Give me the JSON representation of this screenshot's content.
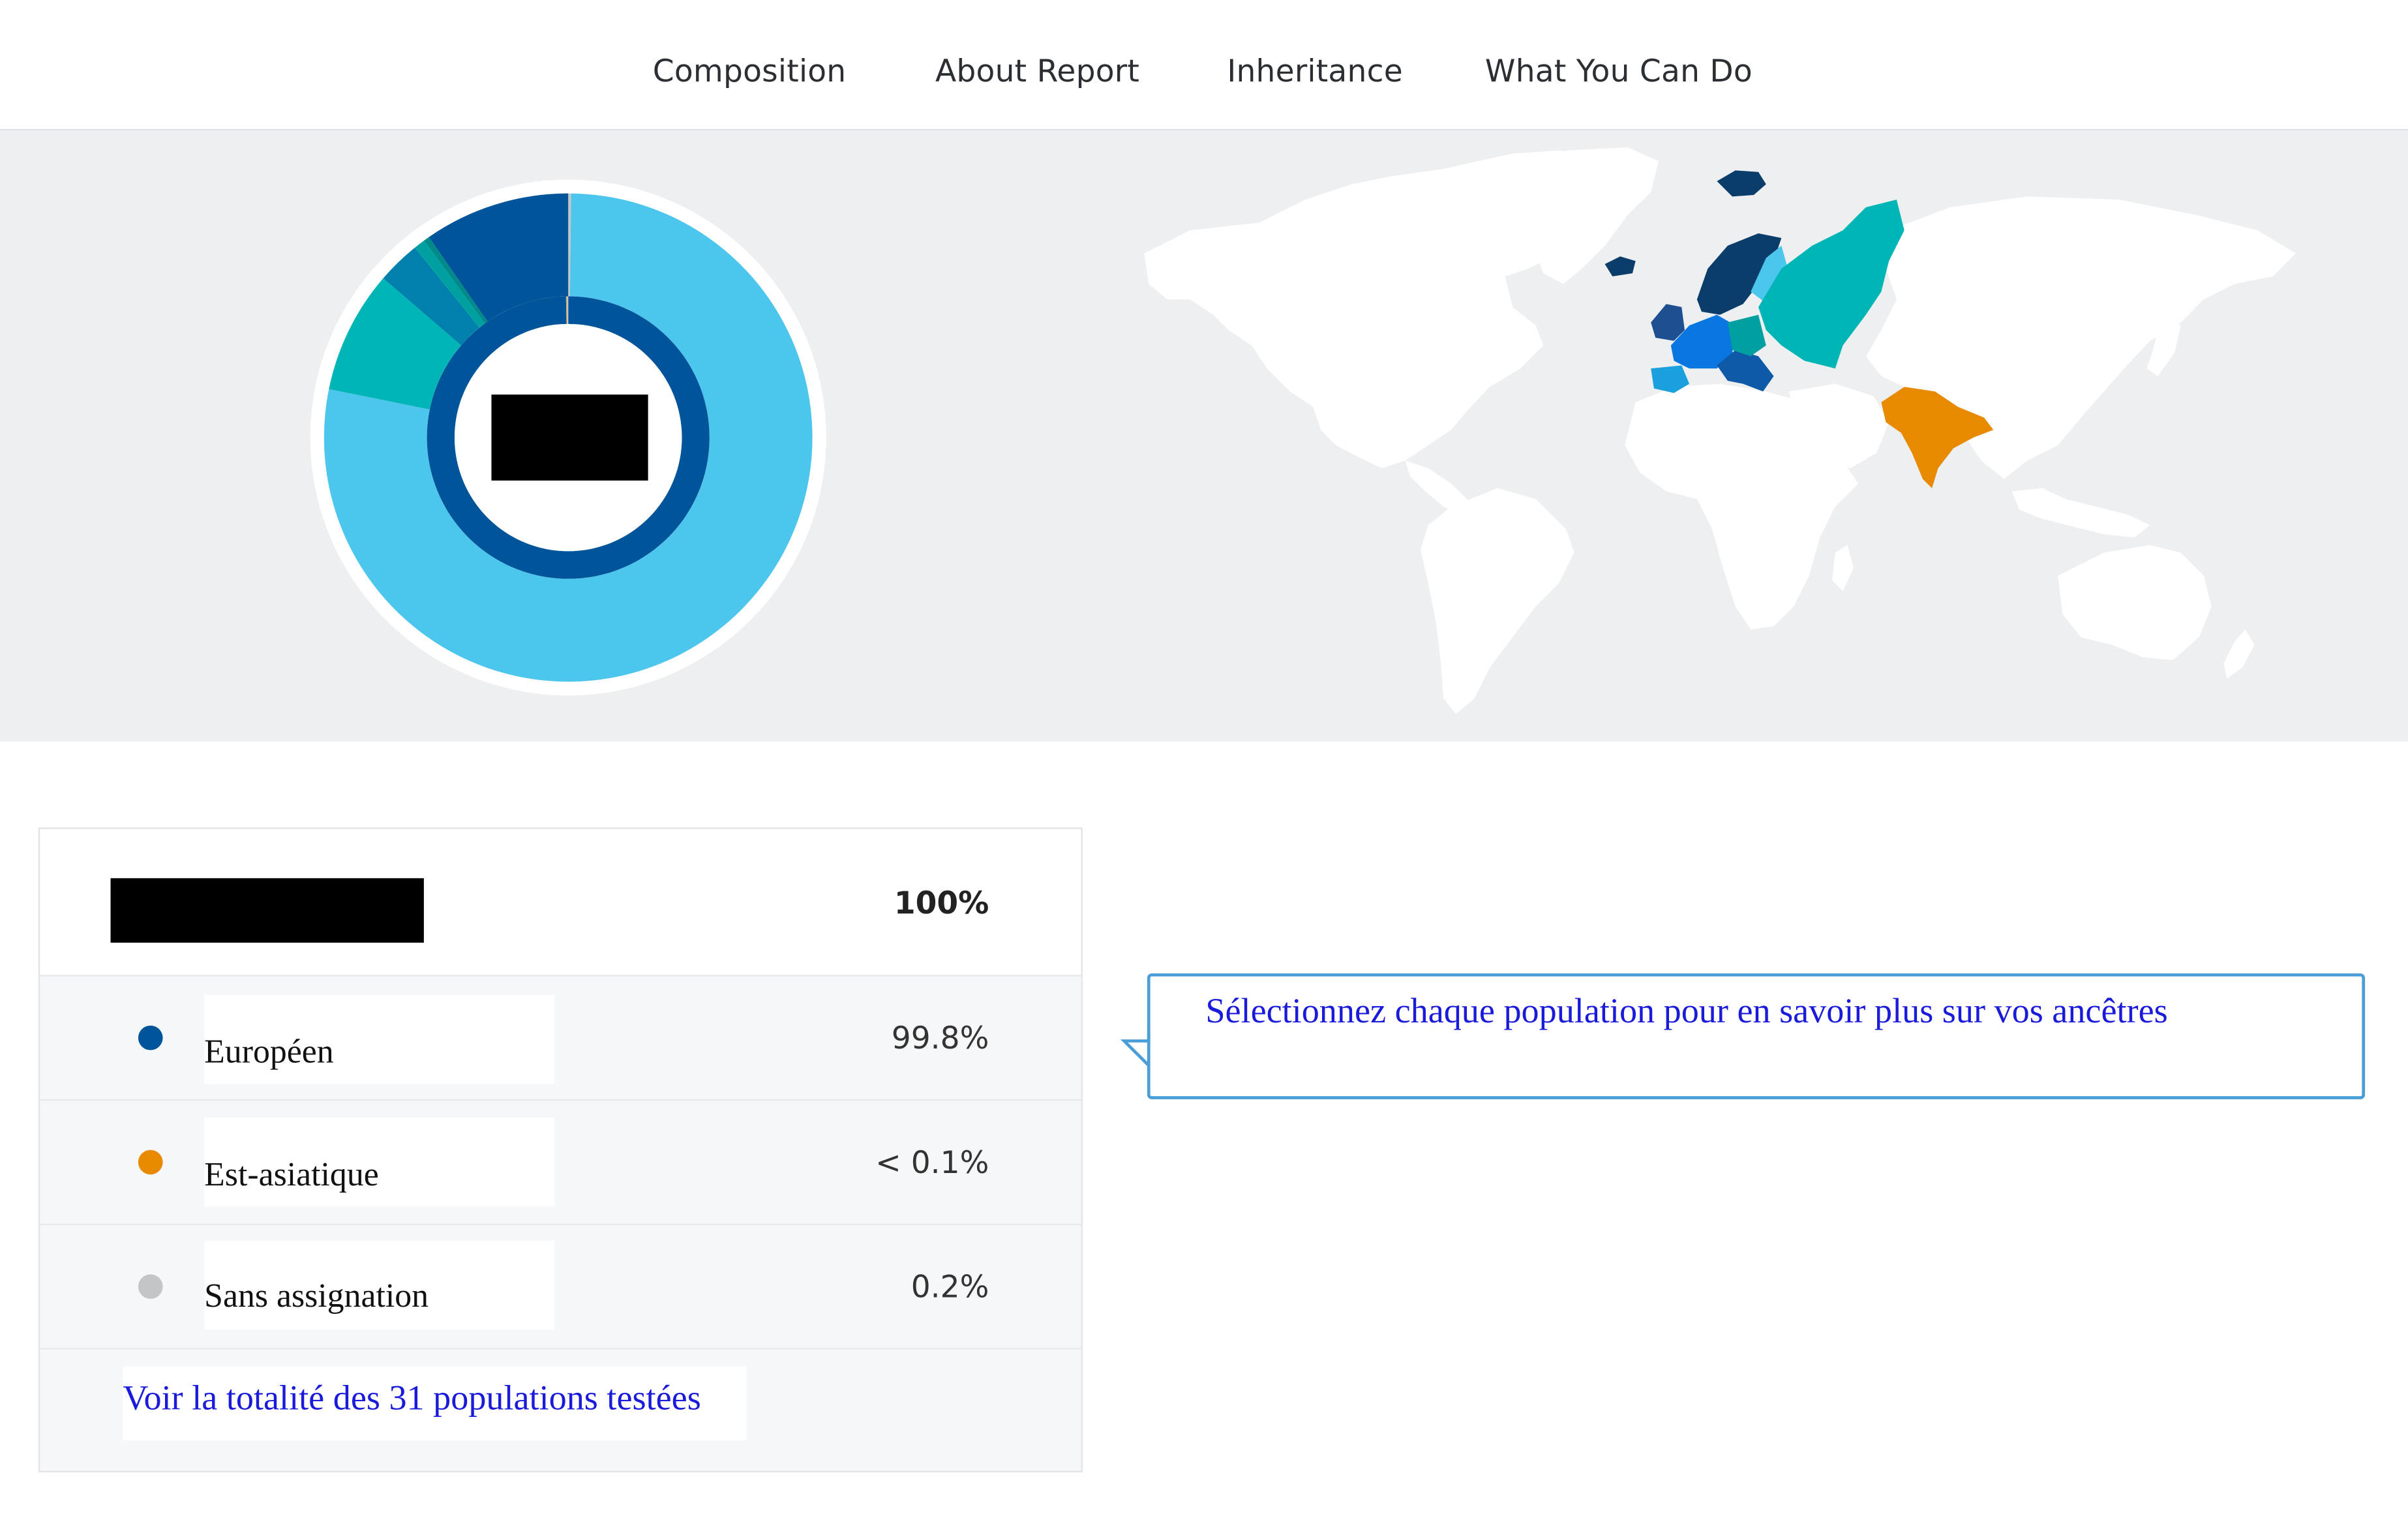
{
  "nav": {
    "tabs": [
      {
        "label": "Composition"
      },
      {
        "label": "About Report"
      },
      {
        "label": "Inheritance"
      },
      {
        "label": "What You Can Do"
      }
    ]
  },
  "colors": {
    "european_dark": "#00549a",
    "european_light": "#4dc6ee",
    "teal": "#00b5b6",
    "east_asian": "#e88a00",
    "unassigned": "#c3c6c9",
    "link": "#1a1adb",
    "map_land": "#ffffff",
    "hero_bg": "#eeeff1"
  },
  "panel": {
    "total_percent": "100%",
    "populations": [
      {
        "label": "Européen",
        "percent": "99.8%",
        "color": "#00549a"
      },
      {
        "label": "Est-asiatique",
        "percent": "< 0.1%",
        "color": "#e88a00"
      },
      {
        "label": "Sans assignation",
        "percent": "0.2%",
        "color": "#c3c6c9"
      }
    ],
    "see_all_link": "Voir la totalité des 31 populations testées"
  },
  "callout": {
    "text": "Sélectionnez chaque population pour en savoir plus sur vos ancêtres"
  },
  "chart_data": {
    "type": "pie",
    "title": "",
    "inner_ring": {
      "categories": [
        "Européen",
        "Est-asiatique",
        "Sans assignation"
      ],
      "values": [
        99.8,
        0.05,
        0.2
      ],
      "colors": [
        "#00549a",
        "#e88a00",
        "#c3c6c9"
      ]
    },
    "outer_ring": {
      "values": [
        0.2,
        81.5,
        8.5,
        3.0,
        0.8,
        0.4,
        10.1
      ],
      "colors": [
        "#c3c6c9",
        "#4dc6ee",
        "#00b5b6",
        "#0081ad",
        "#00a0a0",
        "#008a8a",
        "#00549a"
      ]
    }
  }
}
